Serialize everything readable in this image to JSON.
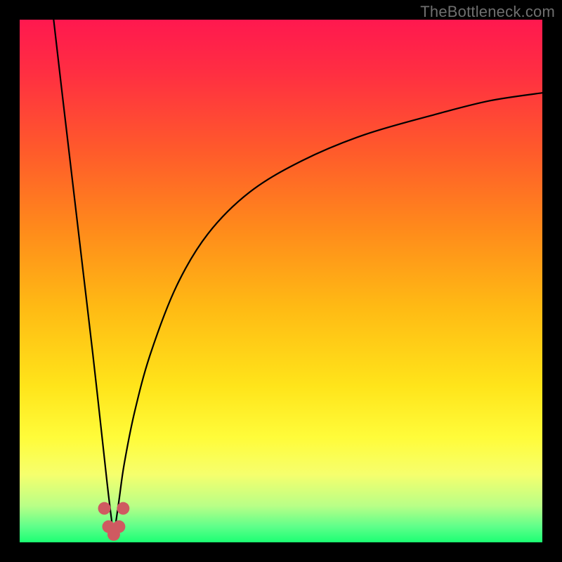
{
  "watermark": "TheBottleneck.com",
  "gradient": {
    "stops": [
      {
        "offset": 0.0,
        "color": "#ff184f"
      },
      {
        "offset": 0.1,
        "color": "#ff2e42"
      },
      {
        "offset": 0.25,
        "color": "#ff5a2b"
      },
      {
        "offset": 0.4,
        "color": "#ff8a1b"
      },
      {
        "offset": 0.55,
        "color": "#ffba14"
      },
      {
        "offset": 0.7,
        "color": "#ffe41a"
      },
      {
        "offset": 0.8,
        "color": "#fffc3a"
      },
      {
        "offset": 0.87,
        "color": "#f6ff6d"
      },
      {
        "offset": 0.93,
        "color": "#b9ff87"
      },
      {
        "offset": 0.97,
        "color": "#5eff8a"
      },
      {
        "offset": 1.0,
        "color": "#1bff73"
      }
    ]
  },
  "chart_data": {
    "type": "line",
    "title": "",
    "xlabel": "",
    "ylabel": "",
    "xlim": [
      0,
      100
    ],
    "ylim": [
      0,
      100
    ],
    "x_min_at": 18,
    "series": [
      {
        "name": "curve-left",
        "x": [
          6.5,
          8,
          10,
          12,
          14,
          16,
          17,
          18
        ],
        "values": [
          100,
          87,
          70,
          53,
          36,
          18,
          9,
          1
        ]
      },
      {
        "name": "curve-right",
        "x": [
          18,
          19,
          20,
          22,
          25,
          30,
          36,
          44,
          54,
          66,
          80,
          90,
          100
        ],
        "values": [
          1,
          8,
          15,
          25,
          36,
          49,
          59,
          67,
          73,
          78,
          82,
          84.5,
          86
        ]
      }
    ],
    "markers": {
      "name": "valley-markers",
      "color": "#cf5a61",
      "radius_px": 9,
      "points": [
        {
          "x": 16.2,
          "y": 6.5
        },
        {
          "x": 17.0,
          "y": 3.0
        },
        {
          "x": 18.0,
          "y": 1.5
        },
        {
          "x": 19.0,
          "y": 3.0
        },
        {
          "x": 19.8,
          "y": 6.5
        }
      ]
    }
  }
}
